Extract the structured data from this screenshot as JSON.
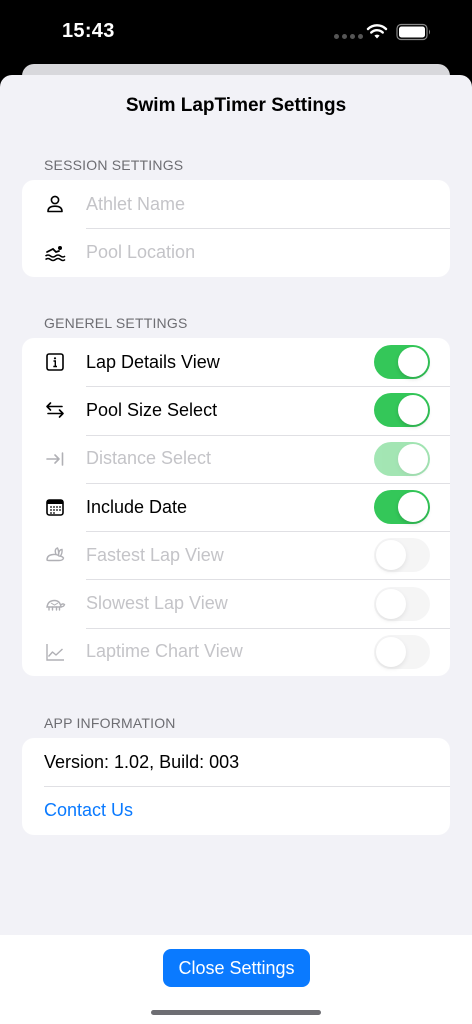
{
  "status": {
    "time": "15:43"
  },
  "sheet": {
    "title": "Swim LapTimer Settings"
  },
  "session": {
    "header": "SESSION SETTINGS",
    "athlete_placeholder": "Athlet Name",
    "pool_placeholder": "Pool Location"
  },
  "general": {
    "header": "GENEREL SETTINGS",
    "items": [
      {
        "label": "Lap Details View",
        "icon": "info-icon",
        "state": "on",
        "enabled": true
      },
      {
        "label": "Pool Size Select",
        "icon": "arrows-left-right-icon",
        "state": "on",
        "enabled": true
      },
      {
        "label": "Distance Select",
        "icon": "arrow-to-line-icon",
        "state": "on",
        "enabled": false
      },
      {
        "label": "Include Date",
        "icon": "calendar-icon",
        "state": "on",
        "enabled": true
      },
      {
        "label": "Fastest Lap View",
        "icon": "hare-icon",
        "state": "off",
        "enabled": false
      },
      {
        "label": "Slowest Lap View",
        "icon": "tortoise-icon",
        "state": "off",
        "enabled": false
      },
      {
        "label": "Laptime Chart View",
        "icon": "chart-line-icon",
        "state": "off",
        "enabled": false
      }
    ]
  },
  "app_info": {
    "header": "APP INFORMATION",
    "version": "Version: 1.02, Build: 003",
    "contact": "Contact Us"
  },
  "footer": {
    "close_label": "Close Settings"
  },
  "colors": {
    "accent": "#0a7aff",
    "toggle_on": "#34c759",
    "background": "#f2f2f7"
  }
}
